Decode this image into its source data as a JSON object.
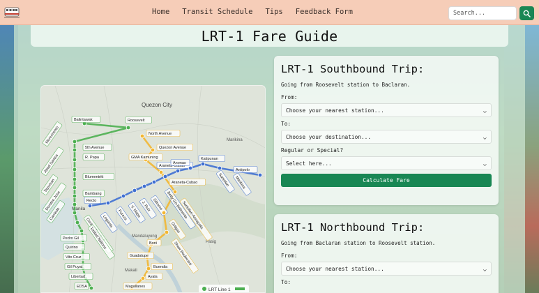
{
  "navbar": {
    "links": [
      "Home",
      "Transit Schedule",
      "Tips",
      "Feedback Form"
    ],
    "search_placeholder": "Search...",
    "search_icon": "search-icon",
    "brand_icon": "train-logo-icon"
  },
  "page_title": "LRT-1 Fare Guide",
  "map": {
    "city_labels": [
      "Quezon City",
      "Marikina",
      "Manila",
      "Mandaluyong",
      "Pasig",
      "Makati"
    ],
    "legend": "LRT Line 1",
    "lrt1_stations": [
      "Balintawak",
      "Roosevelt",
      "Monumento",
      "5th Avenue",
      "R. Papa",
      "Abad Santos",
      "Blumentritt",
      "Tayuman",
      "Bambang",
      "Doroteo Jose",
      "Carriedo",
      "Central Terminal",
      "United Nations",
      "Pedro Gil",
      "Quirino",
      "Vito Cruz",
      "Gil Puyat",
      "Libertad",
      "EDSA"
    ],
    "lrt2_stations": [
      "Recto",
      "Legarda",
      "Pureza",
      "V. Mapa",
      "J. Ruiz",
      "Gilmore",
      "Betty Go-Belmonte",
      "Araneta-Cubao",
      "Anonas",
      "Katipunan",
      "Santolan",
      "Marikina",
      "Antipolo"
    ],
    "mrt3_stations": [
      "North Avenue",
      "Quezon Avenue",
      "GMA Kamuning",
      "Araneta-Cubao",
      "Santolan-Annapolis",
      "Ortigas",
      "Shaw Boulevard",
      "Boni",
      "Guadalupe",
      "Buendia",
      "Ayala",
      "Magallanes"
    ],
    "colors": {
      "lrt1": "#4caf50",
      "lrt2": "#3f6fd1",
      "mrt3": "#f2b632"
    }
  },
  "southbound": {
    "title": "LRT-1 Southbound Trip:",
    "description": "Going from Roosevelt station to Baclaran.",
    "from_label": "From:",
    "from_value": "Choose your nearest station...",
    "to_label": "To:",
    "to_value": "Choose your destination...",
    "type_label": "Regular or Special?",
    "type_value": "Select here...",
    "button": "Calculate Fare"
  },
  "northbound": {
    "title": "LRT-1 Northbound Trip:",
    "description": "Going from Baclaran station to Roosevelt station.",
    "from_label": "From:",
    "from_value": "Choose your nearest station...",
    "to_label": "To:"
  },
  "colors": {
    "accent": "#198754",
    "navbar": "#f6cdb8"
  }
}
